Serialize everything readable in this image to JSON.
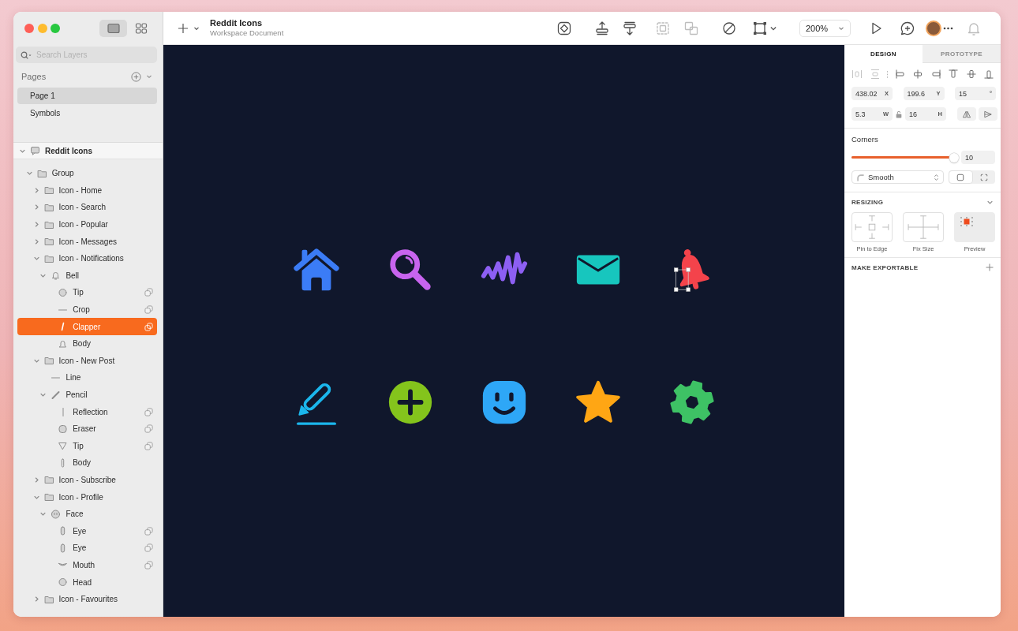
{
  "sidebar": {
    "view_modes": [
      {
        "kind": "canvas",
        "selected": true
      },
      {
        "kind": "grid",
        "selected": false
      }
    ],
    "search": {
      "placeholder": "Search Layers"
    },
    "pages": {
      "title": "Pages",
      "items": [
        {
          "name": "Page 1",
          "selected": true
        },
        {
          "name": "Symbols",
          "selected": false
        }
      ]
    },
    "layers": [
      {
        "name": "Reddit Icons",
        "kind": "artboard",
        "expanded": true,
        "selected": false,
        "children": [
          {
            "name": "Group",
            "kind": "folder",
            "expanded": true,
            "selected": false,
            "children": [
              {
                "name": "Icon - Home",
                "kind": "folder",
                "expanded": false,
                "selected": false
              },
              {
                "name": "Icon - Search",
                "kind": "folder",
                "expanded": false,
                "selected": false
              },
              {
                "name": "Icon - Popular",
                "kind": "folder",
                "expanded": false,
                "selected": false
              },
              {
                "name": "Icon - Messages",
                "kind": "folder",
                "expanded": false,
                "selected": false
              },
              {
                "name": "Icon - Notifications",
                "kind": "folder",
                "expanded": true,
                "selected": false,
                "children": [
                  {
                    "name": "Bell",
                    "kind": "bell",
                    "expanded": true,
                    "selected": false,
                    "children": [
                      {
                        "name": "Tip",
                        "kind": "circle",
                        "selected": false,
                        "boolean": true
                      },
                      {
                        "name": "Crop",
                        "kind": "line",
                        "selected": false,
                        "boolean": true
                      },
                      {
                        "name": "Clapper",
                        "kind": "clapper",
                        "selected": true,
                        "boolean": true
                      },
                      {
                        "name": "Body",
                        "kind": "bell-body",
                        "selected": false,
                        "boolean": false
                      }
                    ]
                  }
                ]
              },
              {
                "name": "Icon - New Post",
                "kind": "folder",
                "expanded": true,
                "selected": false,
                "children": [
                  {
                    "name": "Line",
                    "kind": "line",
                    "selected": false,
                    "boolean": false
                  },
                  {
                    "name": "Pencil",
                    "kind": "pencil",
                    "expanded": true,
                    "selected": false,
                    "children": [
                      {
                        "name": "Reflection",
                        "kind": "vline",
                        "selected": false,
                        "boolean": true
                      },
                      {
                        "name": "Eraser",
                        "kind": "rounded",
                        "selected": false,
                        "boolean": true
                      },
                      {
                        "name": "Tip",
                        "kind": "triangle",
                        "selected": false,
                        "boolean": true
                      },
                      {
                        "name": "Body",
                        "kind": "vbar",
                        "selected": false,
                        "boolean": false
                      }
                    ]
                  }
                ]
              },
              {
                "name": "Icon - Subscribe",
                "kind": "folder",
                "expanded": false,
                "selected": false
              },
              {
                "name": "Icon - Profile",
                "kind": "folder",
                "expanded": true,
                "selected": false,
                "children": [
                  {
                    "name": "Face",
                    "kind": "face",
                    "expanded": true,
                    "selected": false,
                    "children": [
                      {
                        "name": "Eye",
                        "kind": "capsule",
                        "selected": false,
                        "boolean": true
                      },
                      {
                        "name": "Eye",
                        "kind": "capsule",
                        "selected": false,
                        "boolean": true
                      },
                      {
                        "name": "Mouth",
                        "kind": "mouth",
                        "selected": false,
                        "boolean": true
                      },
                      {
                        "name": "Head",
                        "kind": "circle",
                        "selected": false,
                        "boolean": false
                      }
                    ]
                  }
                ]
              },
              {
                "name": "Icon - Favourites",
                "kind": "folder",
                "expanded": false,
                "selected": false
              }
            ]
          }
        ]
      }
    ]
  },
  "toolbar": {
    "title": "Reddit Icons",
    "subtitle": "Workspace Document",
    "tools": [
      {
        "kind": "symbol",
        "disabled": false
      },
      {
        "kind": "forward",
        "disabled": false
      },
      {
        "kind": "backward",
        "disabled": false
      },
      {
        "kind": "group",
        "disabled": true
      },
      {
        "kind": "ungroup",
        "disabled": true
      },
      {
        "kind": "mask",
        "disabled": false
      },
      {
        "kind": "scale",
        "disabled": false
      }
    ],
    "zoom": "200%"
  },
  "canvas": {
    "icons": [
      {
        "kind": "house",
        "color": "#3b7cf6",
        "selected": false
      },
      {
        "kind": "magnifier",
        "color": "#c864ee",
        "selected": false
      },
      {
        "kind": "wave",
        "color": "#8d5ff3",
        "selected": false
      },
      {
        "kind": "envelope",
        "color": "#17c6be",
        "selected": false
      },
      {
        "kind": "bell",
        "color": "#f4434b",
        "selected": true
      },
      {
        "kind": "pencil",
        "color": "#1bb6ec",
        "selected": false
      },
      {
        "kind": "plus-circle",
        "color": "#84c41c",
        "selected": false
      },
      {
        "kind": "smiley",
        "color": "#2ea7f7",
        "selected": false
      },
      {
        "kind": "star",
        "color": "#ffa614",
        "selected": false
      },
      {
        "kind": "gear",
        "color": "#3ec265",
        "selected": false
      }
    ]
  },
  "inspector": {
    "tabs": [
      {
        "label": "DESIGN",
        "selected": true
      },
      {
        "label": "PROTOTYPE",
        "selected": false
      }
    ],
    "distribute": [
      {
        "kind": "horizontal",
        "disabled": true
      },
      {
        "kind": "vertical",
        "disabled": true
      }
    ],
    "align": [
      {
        "kind": "left",
        "disabled": false
      },
      {
        "kind": "center",
        "disabled": false
      },
      {
        "kind": "right",
        "disabled": false
      },
      {
        "kind": "top",
        "disabled": false
      },
      {
        "kind": "middle",
        "disabled": false
      },
      {
        "kind": "bottom",
        "disabled": false
      }
    ],
    "position": [
      {
        "value": "438.02",
        "suffix": "X"
      },
      {
        "value": "199.6",
        "suffix": "Y"
      },
      {
        "value": "15",
        "suffix": "°"
      }
    ],
    "size": [
      {
        "value": "5.3",
        "suffix": "W"
      },
      {
        "value": "16",
        "suffix": "H"
      }
    ],
    "flip": [
      {
        "kind": "horizontal"
      },
      {
        "kind": "vertical"
      }
    ],
    "corners": {
      "label": "Corners",
      "level": 0.97,
      "value": "10",
      "style": "Smooth"
    },
    "corner_modes": [
      {
        "kind": "square",
        "selected": true
      },
      {
        "kind": "dashed",
        "selected": false
      }
    ],
    "resizing": {
      "title": "RESIZING",
      "options": [
        {
          "kind": "pin",
          "label": "Pin to Edge"
        },
        {
          "kind": "fix",
          "label": "Fix Size"
        },
        {
          "kind": "preview",
          "label": "Preview"
        }
      ]
    },
    "export": {
      "title": "MAKE EXPORTABLE"
    }
  }
}
